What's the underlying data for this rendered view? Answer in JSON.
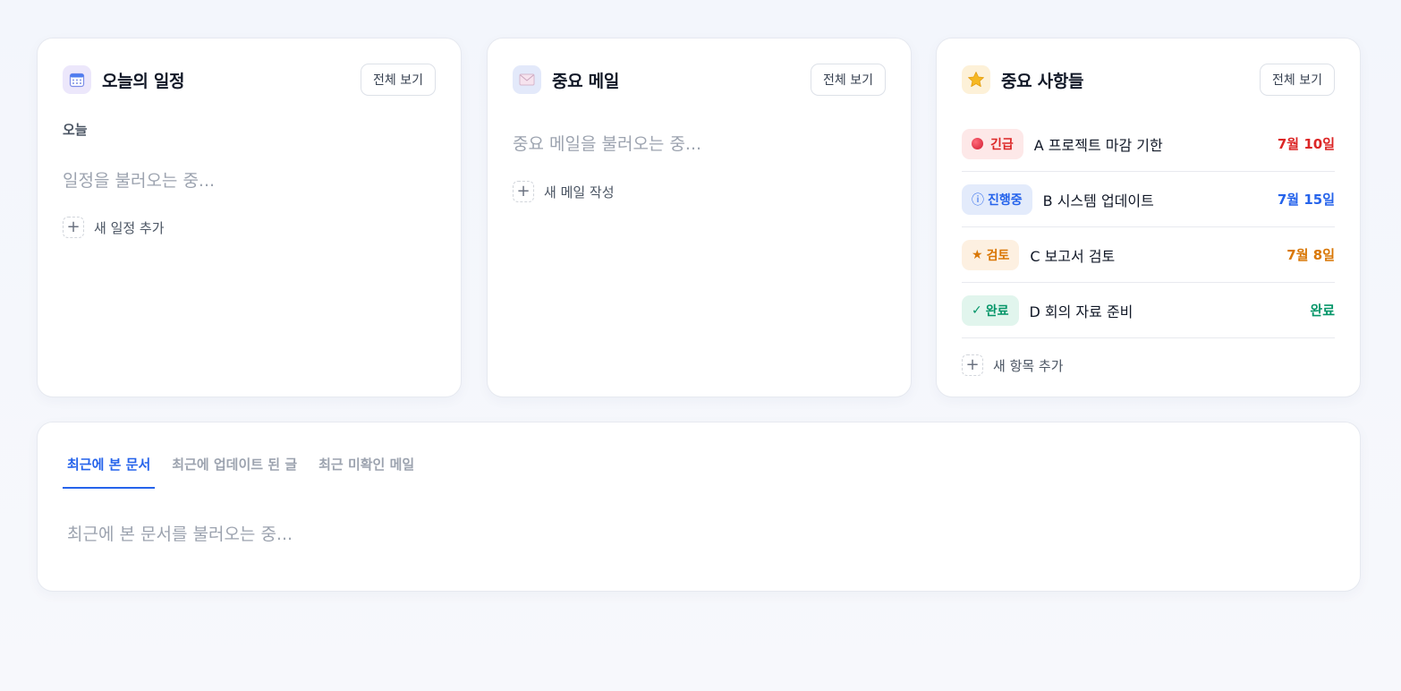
{
  "schedule": {
    "title": "오늘의 일정",
    "icon": "calendar-icon",
    "view_all": "전체 보기",
    "section_label": "오늘",
    "loading": "일정을 불러오는 중...",
    "add_label": "새 일정 추가"
  },
  "mail": {
    "title": "중요 메일",
    "icon": "mail-icon",
    "view_all": "전체 보기",
    "loading": "중요 메일을 불러오는 중...",
    "add_label": "새 메일 작성"
  },
  "important": {
    "title": "중요 사항들",
    "icon": "star-icon",
    "view_all": "전체 보기",
    "items": [
      {
        "badge_icon": "●",
        "badge": "긴급",
        "title": "A 프로젝트 마감 기한",
        "date": "7월 10일",
        "color": "#dc2626",
        "bg": "#fde8e8"
      },
      {
        "badge_icon": "ⓘ",
        "badge": "진행중",
        "title": "B 시스템 업데이트",
        "date": "7월 15일",
        "color": "#2563eb",
        "bg": "#e3ebfb"
      },
      {
        "badge_icon": "★",
        "badge": "검토",
        "title": "C 보고서 검토",
        "date": "7월 8일",
        "color": "#d97706",
        "bg": "#fdf0e1"
      },
      {
        "badge_icon": "✓",
        "badge": "완료",
        "title": "D 회의 자료 준비",
        "date": "완료",
        "color": "#059669",
        "bg": "#e1f5ed"
      }
    ],
    "add_label": "새 항목 추가"
  },
  "recent": {
    "tabs": [
      "최근에 본 문서",
      "최근에 업데이트 된 글",
      "최근 미확인 메일"
    ],
    "active_tab": 0,
    "loading": "최근에 본 문서를 불러오는 중..."
  }
}
